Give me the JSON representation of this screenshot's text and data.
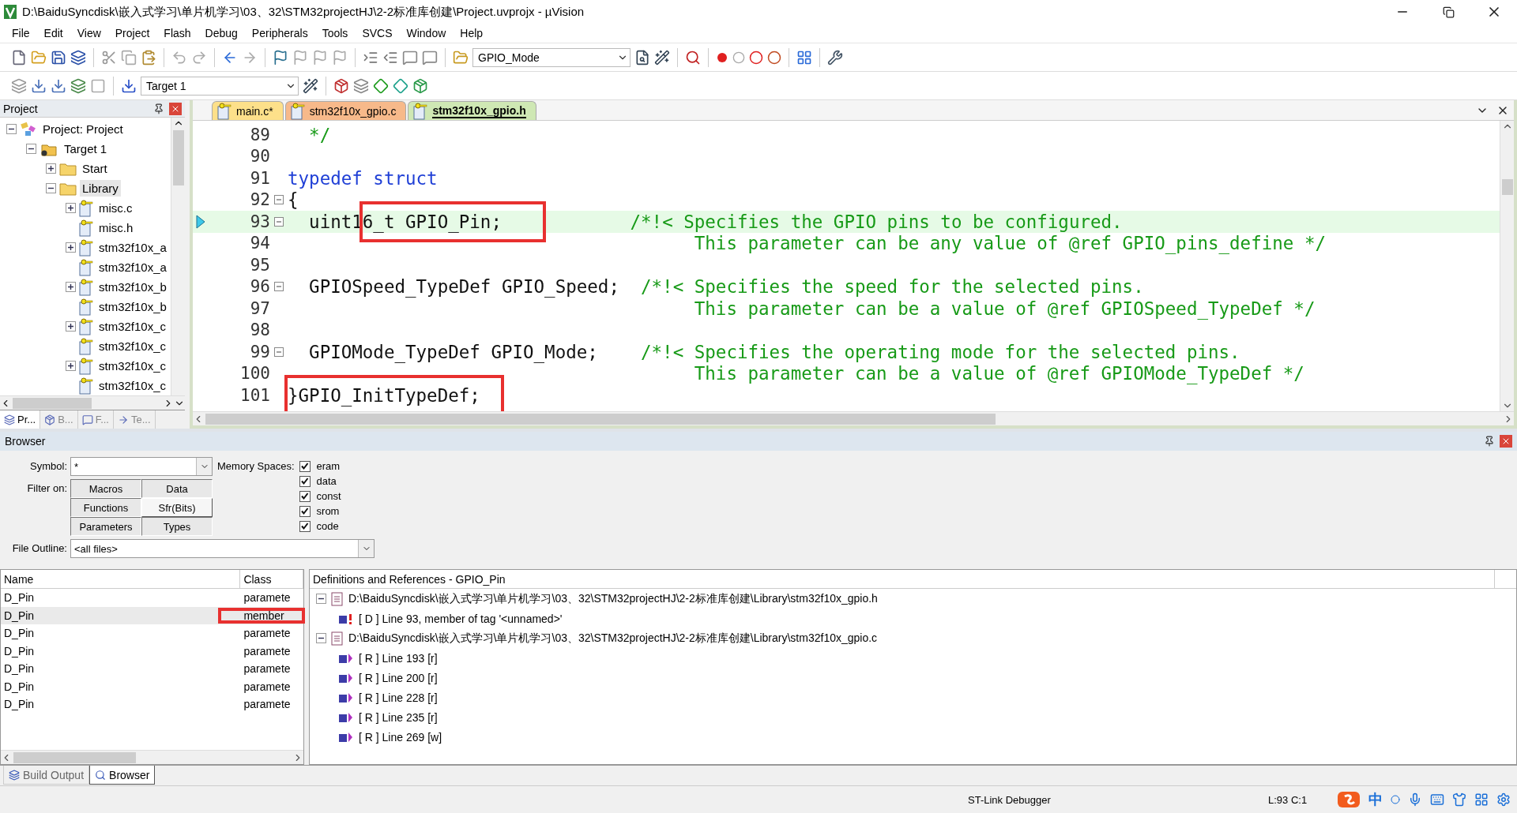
{
  "window": {
    "title": "D:\\BaiduSyncdisk\\嵌入式学习\\单片机学习\\03、32\\STM32projectHJ\\2-2标准库创建\\Project.uvprojx - µVision"
  },
  "menu": [
    "File",
    "Edit",
    "View",
    "Project",
    "Flash",
    "Debug",
    "Peripherals",
    "Tools",
    "SVCS",
    "Window",
    "Help"
  ],
  "toolbar": {
    "find_combo": "GPIO_Mode",
    "target_combo": "Target 1"
  },
  "project_panel": {
    "title": "Project",
    "tree": [
      {
        "label": "Project: Project",
        "kind": "project",
        "expanded": true,
        "selected": false,
        "children": [
          {
            "label": "Target 1",
            "kind": "target",
            "expanded": true,
            "selected": false,
            "children": [
              {
                "label": "Start",
                "kind": "folder",
                "expanded": false,
                "selected": false
              },
              {
                "label": "Library",
                "kind": "folder",
                "expanded": true,
                "selected": true,
                "children": [
                  {
                    "label": "misc.c",
                    "kind": "file",
                    "expanded": false,
                    "selected": false
                  },
                  {
                    "label": "misc.h",
                    "kind": "file",
                    "selected": false
                  },
                  {
                    "label": "stm32f10x_a",
                    "kind": "file",
                    "expanded": false,
                    "selected": false
                  },
                  {
                    "label": "stm32f10x_a",
                    "kind": "file",
                    "selected": false
                  },
                  {
                    "label": "stm32f10x_b",
                    "kind": "file",
                    "expanded": false,
                    "selected": false
                  },
                  {
                    "label": "stm32f10x_b",
                    "kind": "file",
                    "selected": false
                  },
                  {
                    "label": "stm32f10x_c",
                    "kind": "file",
                    "expanded": false,
                    "selected": false
                  },
                  {
                    "label": "stm32f10x_c",
                    "kind": "file",
                    "selected": false
                  },
                  {
                    "label": "stm32f10x_c",
                    "kind": "file",
                    "expanded": false,
                    "selected": false
                  },
                  {
                    "label": "stm32f10x_c",
                    "kind": "file",
                    "selected": false
                  }
                ]
              }
            ]
          }
        ]
      }
    ],
    "tabs": [
      {
        "label": "Pr...",
        "kind": "project",
        "selected": true
      },
      {
        "label": "B...",
        "kind": "books",
        "selected": false
      },
      {
        "label": "F...",
        "kind": "functions",
        "selected": false
      },
      {
        "label": "Te...",
        "kind": "templates",
        "selected": false
      }
    ]
  },
  "editor": {
    "tabs": [
      {
        "label": "main.c*",
        "color": "#fde08a",
        "selected": false
      },
      {
        "label": "stm32f10x_gpio.c",
        "color": "#f7b98a",
        "selected": false
      },
      {
        "label": "stm32f10x_gpio.h",
        "color": "#cfe8b4",
        "selected": true
      }
    ],
    "lines": [
      {
        "number": "89",
        "fold": false,
        "current": false,
        "segments": [
          {
            "kind": "comment",
            "text": "  */"
          }
        ]
      },
      {
        "number": "90",
        "fold": false,
        "current": false
      },
      {
        "number": "91",
        "fold": false,
        "current": false,
        "segments": [
          {
            "kind": "keyword",
            "text": "typedef struct"
          }
        ]
      },
      {
        "number": "92",
        "fold": true,
        "current": false,
        "segments": [
          {
            "kind": "code",
            "text": "{"
          }
        ]
      },
      {
        "number": "93",
        "fold": true,
        "current": true,
        "segments": [
          {
            "kind": "code",
            "text": "  uint1"
          },
          {
            "kind": "code",
            "text": "6_t GPIO_Pin;",
            "boxed": true
          },
          {
            "kind": "comment",
            "text": "            /*!< Specifies the GPIO pins to be configured."
          }
        ]
      },
      {
        "number": "94",
        "fold": false,
        "current": false,
        "segments": [
          {
            "kind": "comment",
            "text": "                                      This parameter can be any value of @ref GPIO_pins_define */"
          }
        ]
      },
      {
        "number": "95",
        "fold": false,
        "current": false
      },
      {
        "number": "96",
        "fold": true,
        "current": false,
        "segments": [
          {
            "kind": "code",
            "text": "  GPIOSpeed_TypeDef GPIO_Speed;"
          },
          {
            "kind": "comment",
            "text": "  /*!< Specifies the speed for the selected pins."
          }
        ]
      },
      {
        "number": "97",
        "fold": false,
        "current": false,
        "segments": [
          {
            "kind": "comment",
            "text": "                                      This parameter can be a value of @ref GPIOSpeed_TypeDef */"
          }
        ]
      },
      {
        "number": "98",
        "fold": false,
        "current": false
      },
      {
        "number": "99",
        "fold": true,
        "current": false,
        "segments": [
          {
            "kind": "code",
            "text": "  GPIOMode_TypeDef GPIO_Mode;"
          },
          {
            "kind": "comment",
            "text": "    /*!< Specifies the operating mode for the selected pins."
          }
        ]
      },
      {
        "number": "100",
        "fold": false,
        "current": false,
        "segments": [
          {
            "kind": "comment",
            "text": "                                      This parameter can be a value of @ref GPIOMode_TypeDef */"
          }
        ]
      },
      {
        "number": "101",
        "fold": false,
        "current": false,
        "segments": [
          {
            "kind": "code",
            "text": "}GPIO_InitTypeDef;",
            "boxed": true
          }
        ]
      }
    ]
  },
  "browser": {
    "title": "Browser",
    "symbol": {
      "label": "Symbol:",
      "value": "*"
    },
    "filter": {
      "label": "Filter on:",
      "buttons": [
        {
          "label": "Macros",
          "pressed": true
        },
        {
          "label": "Data",
          "pressed": true
        },
        {
          "label": "Functions",
          "pressed": true
        },
        {
          "label": "Sfr(Bits)",
          "pressed": false
        },
        {
          "label": "Parameters",
          "pressed": true
        },
        {
          "label": "Types",
          "pressed": true
        }
      ]
    },
    "memory": {
      "label": "Memory Spaces:",
      "items": [
        {
          "label": "eram",
          "checked": true
        },
        {
          "label": "data",
          "checked": true
        },
        {
          "label": "const",
          "checked": true
        },
        {
          "label": "srom",
          "checked": true
        },
        {
          "label": "code",
          "checked": true
        }
      ]
    },
    "file_outline": {
      "label": "File Outline:",
      "value": "<all files>"
    },
    "names": {
      "columns": [
        "Name",
        "Class"
      ],
      "rows": [
        {
          "name": "D_Pin",
          "class": "paramete",
          "selected": false,
          "boxed": false
        },
        {
          "name": "D_Pin",
          "class": "member",
          "selected": true,
          "boxed": true
        },
        {
          "name": "D_Pin",
          "class": "paramete",
          "selected": false,
          "boxed": false
        },
        {
          "name": "D_Pin",
          "class": "paramete",
          "selected": false,
          "boxed": false
        },
        {
          "name": "D_Pin",
          "class": "paramete",
          "selected": false,
          "boxed": false
        },
        {
          "name": "D_Pin",
          "class": "paramete",
          "selected": false,
          "boxed": false
        },
        {
          "name": "D_Pin",
          "class": "paramete",
          "selected": false,
          "boxed": false
        }
      ]
    },
    "definitions": {
      "title": "Definitions and References - GPIO_Pin",
      "tree": [
        {
          "label": "D:\\BaiduSyncdisk\\嵌入式学习\\单片机学习\\03、32\\STM32projectHJ\\2-2标准库创建\\Library\\stm32f10x_gpio.h",
          "kind": "file",
          "expanded": true,
          "children": [
            {
              "label": "[ D ] Line 93, member of tag '<unnamed>'",
              "kind": "definition"
            }
          ]
        },
        {
          "label": "D:\\BaiduSyncdisk\\嵌入式学习\\单片机学习\\03、32\\STM32projectHJ\\2-2标准库创建\\Library\\stm32f10x_gpio.c",
          "kind": "file",
          "expanded": true,
          "children": [
            {
              "label": "[ R ] Line 193 [r]",
              "kind": "reference"
            },
            {
              "label": "[ R ] Line 200 [r]",
              "kind": "reference"
            },
            {
              "label": "[ R ] Line 228 [r]",
              "kind": "reference"
            },
            {
              "label": "[ R ] Line 235 [r]",
              "kind": "reference"
            },
            {
              "label": "[ R ] Line 269 [w]",
              "kind": "reference"
            }
          ]
        }
      ]
    }
  },
  "bottom_tabs": [
    {
      "label": "Build Output",
      "selected": false
    },
    {
      "label": "Browser",
      "selected": true
    }
  ],
  "status_bar": {
    "debugger": "ST-Link Debugger",
    "position": "L:93 C:1",
    "ime": "中"
  }
}
